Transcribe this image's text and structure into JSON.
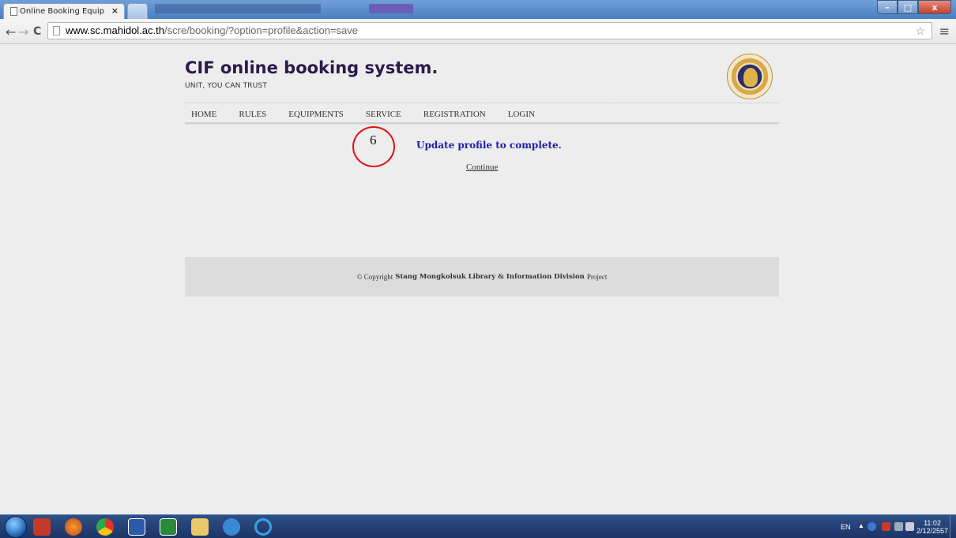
{
  "browser": {
    "tab_title": "Online Booking Equipmer",
    "tab_close": "×",
    "url_host": "www.sc.mahidol.ac.th",
    "url_path": "/scre/booking/?option=profile&action=save",
    "back": "←",
    "forward": "→",
    "reload": "C",
    "star": "☆",
    "menu": "≡"
  },
  "window_controls": {
    "minimize": "–",
    "maximize": "□",
    "close": "x"
  },
  "site": {
    "title": "CIF online booking system.",
    "tagline": "UNIT, YOU CAN TRUST",
    "nav": [
      "HOME",
      "RULES",
      "EQUIPMENTS",
      "SERVICE",
      "REGISTRATION",
      "LOGIN"
    ]
  },
  "annotation": {
    "number": "6"
  },
  "message": {
    "text": "Update profile to complete.",
    "link": "Continue"
  },
  "footer": {
    "prefix": "© Copyright",
    "bold": "Stang Mongkolsuk Library & Information Division",
    "suffix": "Project"
  },
  "taskbar": {
    "lang": "EN",
    "time": "11:02",
    "date": "2/12/2557"
  },
  "colors": {
    "title": "#2a1a4a",
    "message": "#1e20a8",
    "annotation": "#e01010",
    "taskbar": "#1c3466"
  }
}
